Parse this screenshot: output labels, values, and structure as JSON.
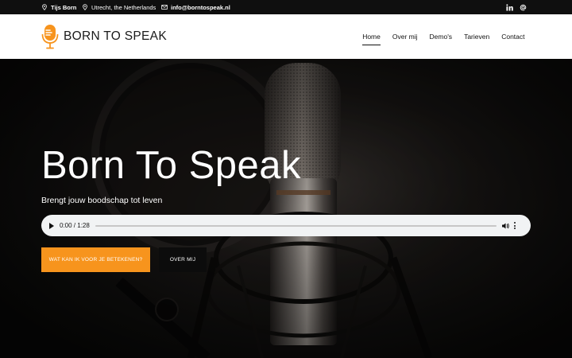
{
  "topbar": {
    "name": "Tijs Born",
    "location": "Utrecht, the Netherlands",
    "email": "info@borntospeak.nl",
    "social": [
      "linkedin-icon",
      "at-icon"
    ]
  },
  "brand": {
    "name": "BORN TO SPEAK",
    "accent": "#f7941d"
  },
  "nav": {
    "items": [
      {
        "label": "Home",
        "active": true
      },
      {
        "label": "Over mij",
        "active": false
      },
      {
        "label": "Demo's",
        "active": false
      },
      {
        "label": "Tarieven",
        "active": false
      },
      {
        "label": "Contact",
        "active": false
      }
    ]
  },
  "hero": {
    "title": "Born To Speak",
    "subtitle": "Brengt jouw boodschap tot leven",
    "audio": {
      "time": "0:00 / 1:28",
      "progress": 0
    },
    "buttons": {
      "primary": "WAT KAN IK VOOR JE BETEKENEN?",
      "secondary": "OVER MIJ"
    }
  }
}
